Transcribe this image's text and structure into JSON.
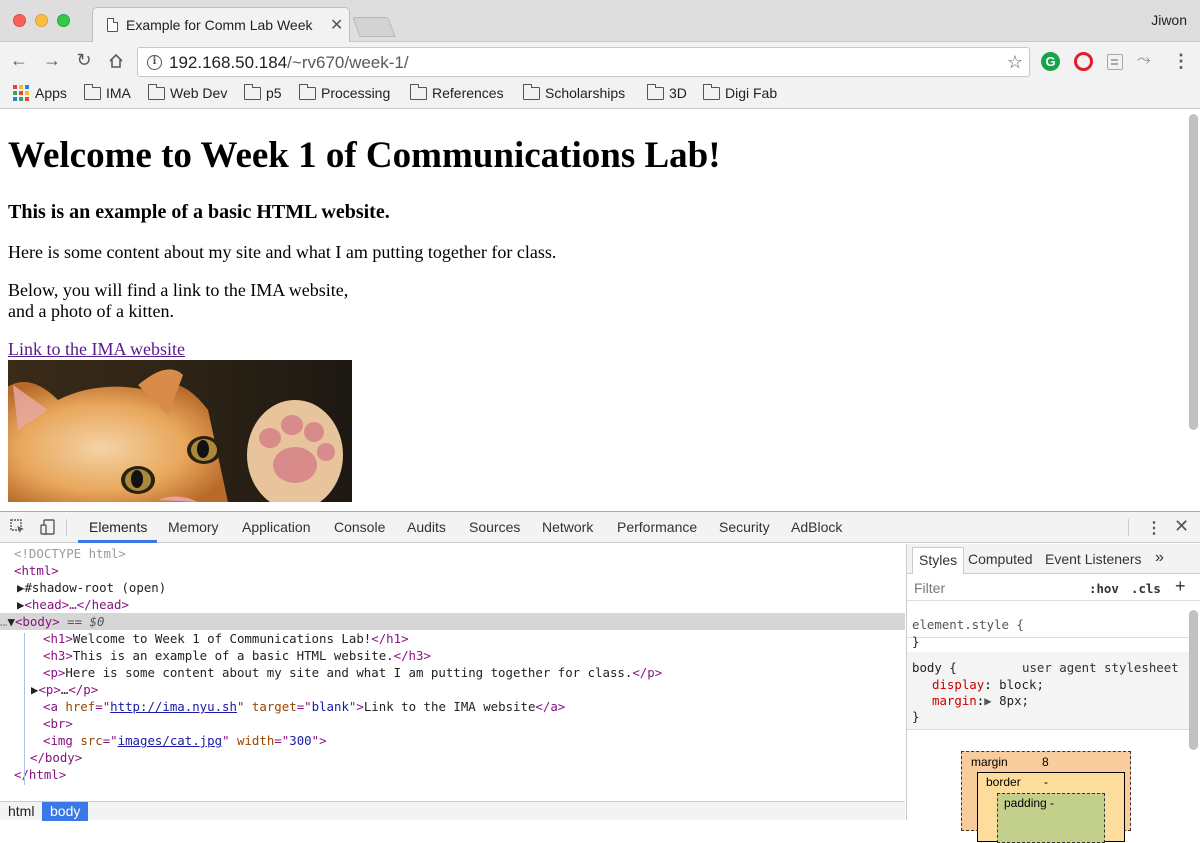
{
  "window": {
    "tab_title": "Example for Comm Lab Week",
    "user_name": "Jiwon"
  },
  "toolbar": {
    "url_host": "192.168.50.184",
    "url_path": "/~rv670/week-1/"
  },
  "bookmarks": {
    "apps_label": "Apps",
    "items": [
      "IMA",
      "Web Dev",
      "p5",
      "Processing",
      "References",
      "Scholarships",
      "3D",
      "Digi Fab"
    ]
  },
  "page": {
    "h1": "Welcome to Week 1 of Communications Lab!",
    "h3": "This is an example of a basic HTML website.",
    "p1": "Here is some content about my site and what I am putting together for class.",
    "p2_line1": "Below, you will find a link to the IMA website,",
    "p2_line2": "and a photo of a kitten.",
    "link_text": "Link to the IMA website"
  },
  "devtools": {
    "tabs": [
      "Elements",
      "Memory",
      "Application",
      "Console",
      "Audits",
      "Sources",
      "Network",
      "Performance",
      "Security",
      "AdBlock"
    ],
    "active_tab": "Elements",
    "accent_color": "#3b78e7",
    "elements": {
      "doctype": "<!DOCTYPE html>",
      "html_open": "<html>",
      "shadow_root": "#shadow-root (open)",
      "head": "<head>…</head>",
      "body_open": "<body>",
      "body_selected_marker": "== $0",
      "h1_text": "Welcome to Week 1 of Communications Lab!",
      "h3_text": "This is an example of a basic HTML website.",
      "p_text": "Here is some content about my site and what I am putting together for class.",
      "p_collapsed": "…",
      "a_href": "http://ima.nyu.sh",
      "a_target": "blank",
      "a_text": "Link to the IMA website",
      "br": "<br>",
      "img_src": "images/cat.jpg",
      "img_width": "300",
      "body_close": "</body>",
      "html_close": "</html>"
    },
    "breadcrumbs": [
      "html",
      "body"
    ],
    "styles": {
      "tabs": [
        "Styles",
        "Computed",
        "Event Listeners"
      ],
      "more": "»",
      "filter_placeholder": "Filter",
      "hov": ":hov",
      "cls": ".cls",
      "add": "+",
      "element_style": "element.style {",
      "close_brace": "}",
      "body_selector": "body {",
      "ua_label": "user agent stylesheet",
      "prop1_name": "display",
      "prop1_value": "block;",
      "prop2_name": "margin",
      "prop2_value": "8px;",
      "box_margin_label": "margin",
      "box_margin_value": "8",
      "box_border_label": "border",
      "box_border_value": "-",
      "box_padding_label": "padding -"
    }
  }
}
